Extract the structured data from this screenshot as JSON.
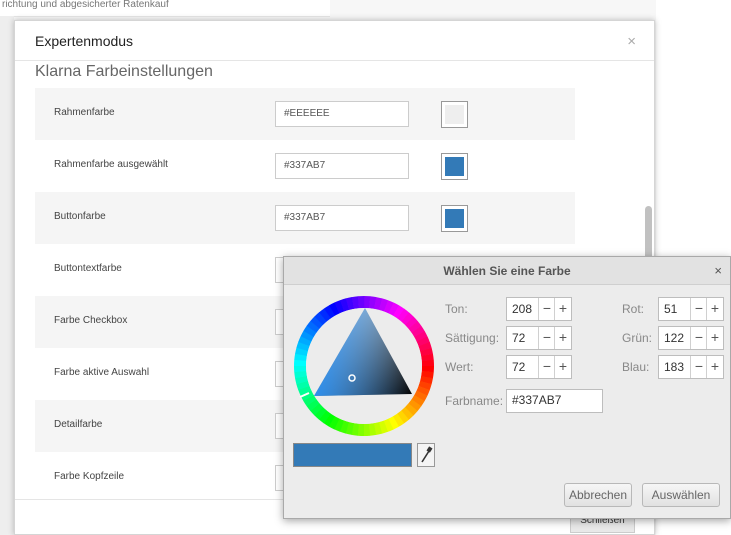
{
  "background": {
    "top_text": "richtung und abgesicherter Ratenkauf"
  },
  "modal": {
    "title": "Expertenmodus",
    "close_glyph": "×",
    "section_title": "Klarna Farbeinstellungen",
    "close_label": "Schließen",
    "rows": [
      {
        "label": "Rahmenfarbe",
        "value": "#EEEEEE",
        "swatch": "#EEEEEE"
      },
      {
        "label": "Rahmenfarbe ausgewählt",
        "value": "#337AB7",
        "swatch": "#337AB7"
      },
      {
        "label": "Buttonfarbe",
        "value": "#337AB7",
        "swatch": "#337AB7"
      },
      {
        "label": "Buttontextfarbe",
        "value": "",
        "swatch": ""
      },
      {
        "label": "Farbe Checkbox",
        "value": "",
        "swatch": ""
      },
      {
        "label": "Farbe aktive Auswahl",
        "value": "",
        "swatch": ""
      },
      {
        "label": "Detailfarbe",
        "value": "",
        "swatch": ""
      },
      {
        "label": "Farbe Kopfzeile",
        "value": "",
        "swatch": ""
      }
    ]
  },
  "picker": {
    "title": "Wählen Sie eine Farbe",
    "close_glyph": "×",
    "current_color": "#337AB7",
    "hue_label": "Ton:",
    "hue": "208",
    "saturation_label": "Sättigung:",
    "saturation": "72",
    "value_label": "Wert:",
    "value": "72",
    "red_label": "Rot:",
    "red": "51",
    "green_label": "Grün:",
    "green": "122",
    "blue_label": "Blau:",
    "blue": "183",
    "colorname_label": "Farbname:",
    "colorname": "#337AB7",
    "minus": "−",
    "plus": "+",
    "cancel_label": "Abbrechen",
    "select_label": "Auswählen"
  }
}
